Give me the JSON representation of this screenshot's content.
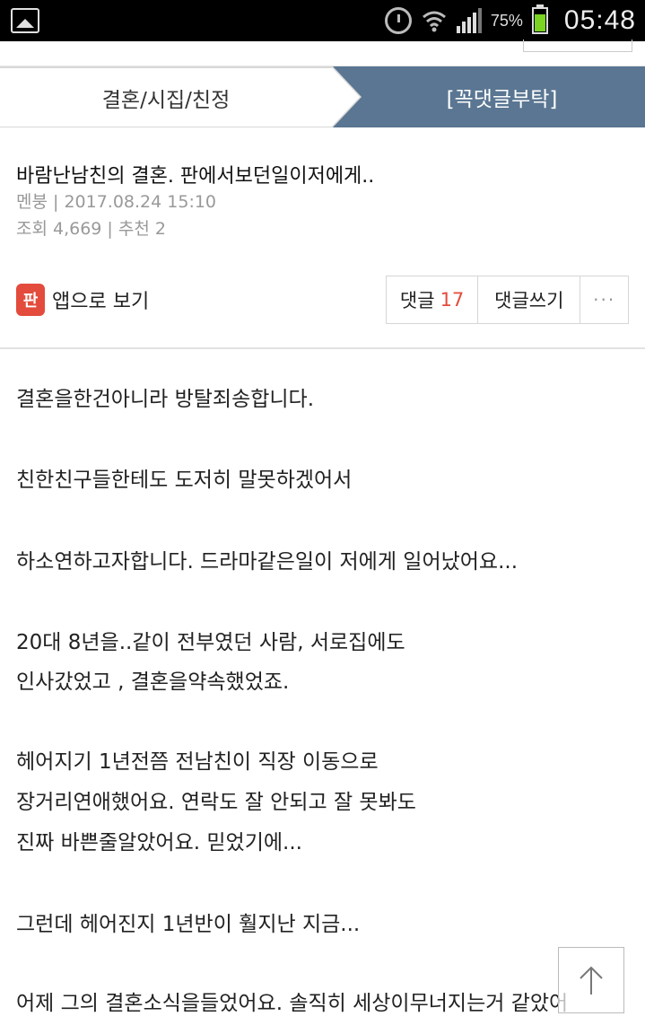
{
  "status_bar": {
    "battery_percent": "75%",
    "battery_level": 0.75,
    "time": "05:48"
  },
  "tabs": {
    "left_label": "결혼/시집/친정",
    "right_label": "[꼭댓글부탁]",
    "active": "right"
  },
  "article": {
    "title": "바람난남친의 결혼. 판에서보던일이저에게..",
    "meta_line": "멘붕   | 2017.08.24 15:10",
    "stats_line": "조회 4,669 | 추천 2"
  },
  "actions": {
    "app_icon_text": "판",
    "app_view_label": "앱으로 보기",
    "comments_label": "댓글",
    "comments_count": "17",
    "write_comment_label": "댓글쓰기",
    "more_label": "···"
  },
  "body": {
    "lines": [
      "결혼을한건아니라 방탈죄송합니다.",
      "친한친구들한테도 도저히 말못하겠어서",
      "하소연하고자합니다. 드라마같은일이 저에게 일어났어요...",
      "20대 8년을..같이 전부였던 사람, 서로집에도",
      "인사갔었고 , 결혼을약속했었죠.",
      "헤어지기 1년전쯤 전남친이 직장 이동으로",
      "장거리연애했어요. 연락도 잘 안되고 잘 못봐도",
      "진짜 바쁜줄알았어요. 믿었기에...",
      "그런데 헤어진지 1년반이 훨지난 지금...",
      "어제 그의 결혼소식을들었어요. 솔직히 세상이무너지는거 같았어"
    ]
  },
  "colors": {
    "tab_active_bg": "#5a7692",
    "accent_red": "#e34b3c",
    "battery_green": "#7bd322"
  }
}
